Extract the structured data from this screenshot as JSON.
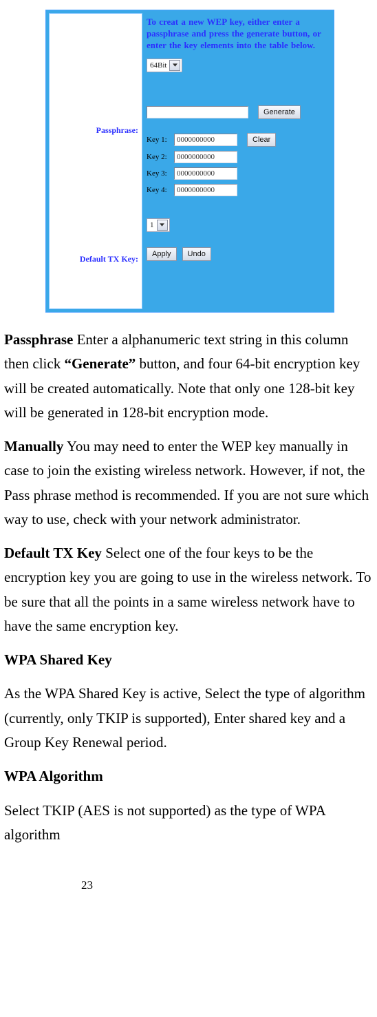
{
  "panel": {
    "hint": "To creat a new WEP key, either enter a passphrase and press the generate button, or enter the key elements into the table below.",
    "bit_select": "64Bit",
    "passphrase_label": "Passphrase:",
    "passphrase_value": "",
    "generate_label": "Generate",
    "clear_label": "Clear",
    "keys": [
      {
        "label": "Key 1:",
        "value": "0000000000"
      },
      {
        "label": "Key 2:",
        "value": "0000000000"
      },
      {
        "label": "Key 3:",
        "value": "0000000000"
      },
      {
        "label": "Key 4:",
        "value": "0000000000"
      }
    ],
    "default_tx_label": "Default TX Key:",
    "default_tx_value": "1",
    "apply_label": "Apply",
    "undo_label": "Undo"
  },
  "doc": {
    "p1_bold": "Passphrase",
    "p1_rest_a": " Enter a alphanumeric text string in this column then click ",
    "p1_bold_mid": "“Generate”",
    "p1_rest_b": " button, and four 64-bit encryption key will be created automatically. Note that only one 128-bit key will be generated in 128-bit encryption mode.",
    "p2_bold": "Manually",
    "p2_rest": " You may need to enter the WEP key manually in case to join the existing wireless network. However, if not, the Pass phrase method is recommended. If you are not sure which way to use, check with your network administrator.",
    "p3_bold": "Default TX Key",
    "p3_rest": " Select one of the four keys to be the encryption key you are going to use in the wireless network. To be sure that all the points in a same wireless network have to have the same encryption key.",
    "h1": "WPA Shared Key",
    "p4": "As the WPA Shared Key is active, Select the type of algorithm (currently, only TKIP is supported), Enter shared key and a Group Key Renewal period.",
    "h2": "WPA Algorithm",
    "p5": "Select TKIP (AES is not supported) as the type of WPA algorithm"
  },
  "page_number": "23"
}
